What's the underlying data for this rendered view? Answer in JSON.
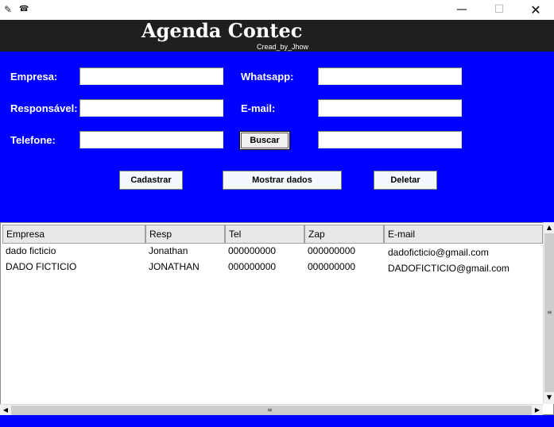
{
  "titlebar": {
    "feather_glyph": "✎",
    "app_glyph": "☎",
    "minimize_glyph": "—",
    "maximize_glyph": "☐",
    "close_glyph": "✕"
  },
  "header": {
    "title": "Agenda Contec",
    "credit": "Cread_by_Jhow"
  },
  "form": {
    "labels": {
      "empresa": "Empresa:",
      "responsavel": "Responsável:",
      "telefone": "Telefone:",
      "whatsapp": "Whatsapp:",
      "email": "E-mail:"
    },
    "values": {
      "empresa": "",
      "responsavel": "",
      "telefone": "",
      "whatsapp": "",
      "email": "",
      "buscar": ""
    },
    "buttons": {
      "buscar": "Buscar",
      "cadastrar": "Cadastrar",
      "mostrar": "Mostrar dados",
      "deletar": "Deletar"
    }
  },
  "table": {
    "columns": [
      "Empresa",
      "Resp",
      "Tel",
      "Zap",
      "E-mail"
    ],
    "rows": [
      [
        "dado ficticio",
        "Jonathan",
        "000000000",
        "000000000",
        "dadoficticio@gmail.com"
      ],
      [
        "DADO FICTICIO",
        "JONATHAN",
        "000000000",
        "000000000",
        "DADOFICTICIO@gmail.com"
      ]
    ]
  },
  "scrollbars": {
    "up_glyph": "▲",
    "down_glyph": "▼",
    "left_glyph": "◀",
    "right_glyph": "▶",
    "grip_glyph": "≡"
  },
  "colors": {
    "form_background": "#0000ff",
    "header_background": "#1f1f1f"
  }
}
